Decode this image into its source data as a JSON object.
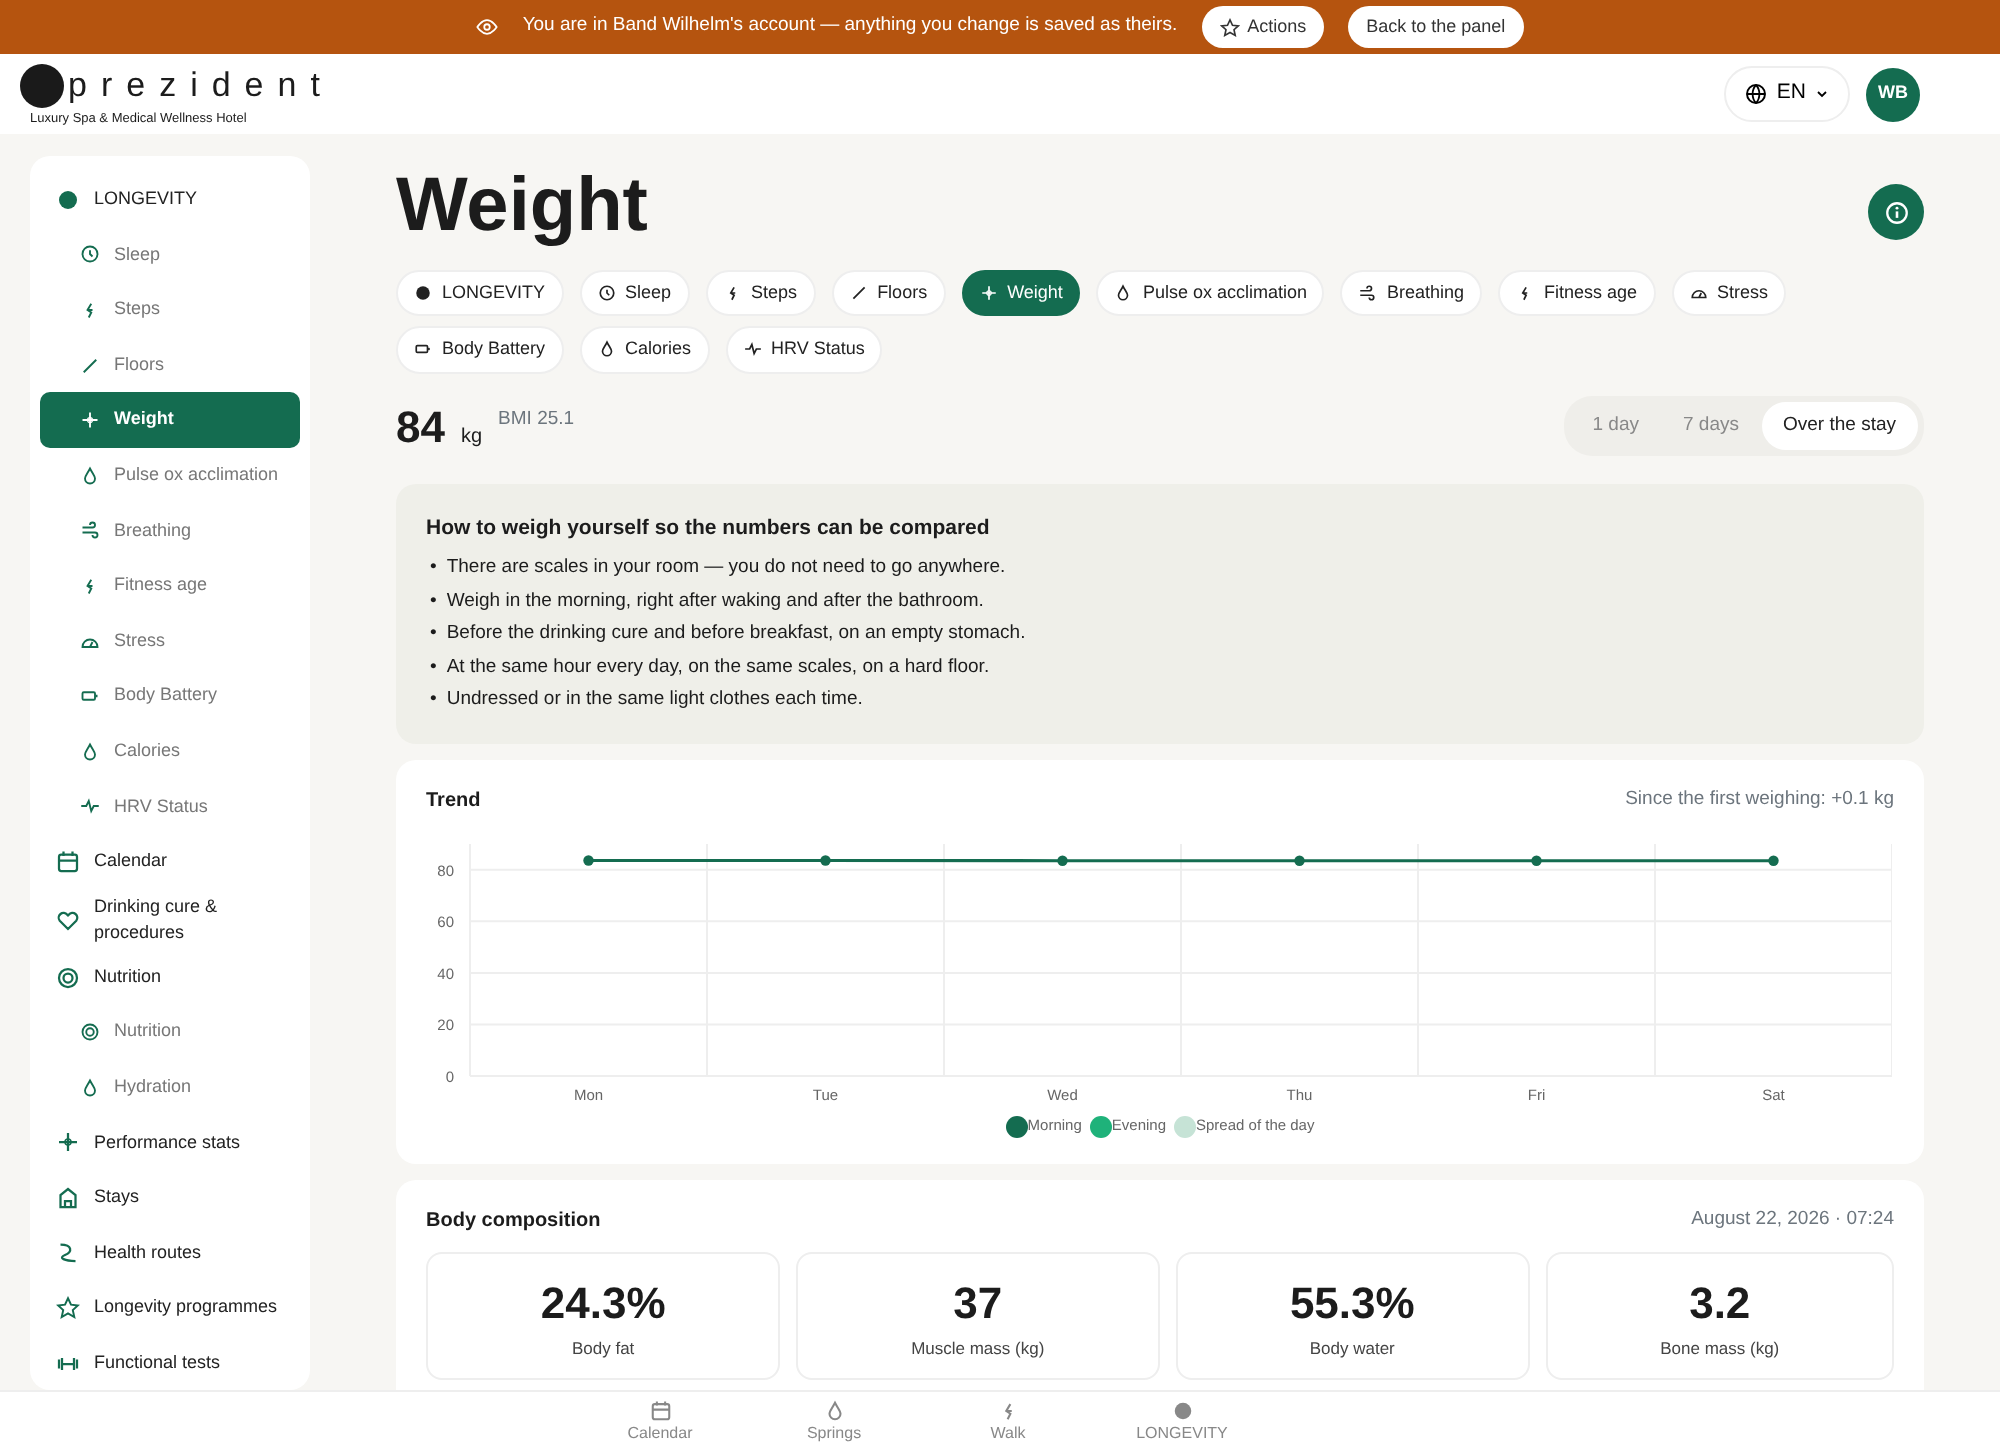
{
  "banner": {
    "text": "You are in Band Wilhelm's account — anything you change is saved as theirs.",
    "buttons": [
      {
        "label": "Actions",
        "kind": "icon"
      },
      {
        "label": "Back to the panel",
        "kind": "plain"
      }
    ]
  },
  "header": {
    "logo": {
      "name": "prezident",
      "tagline": "Luxury Spa & Medical Wellness Hotel"
    },
    "language": "EN",
    "avatar": "WB"
  },
  "sidebar": {
    "items": [
      {
        "label": "LONGEVITY",
        "selected": false,
        "children": [
          {
            "label": "Sleep",
            "selected": false
          },
          {
            "label": "Steps",
            "selected": false
          },
          {
            "label": "Floors",
            "selected": false
          },
          {
            "label": "Weight",
            "selected": true
          },
          {
            "label": "Pulse ox acclimation",
            "selected": false
          },
          {
            "label": "Breathing",
            "selected": false
          },
          {
            "label": "Fitness age",
            "selected": false
          },
          {
            "label": "Stress",
            "selected": false
          },
          {
            "label": "Body Battery",
            "selected": false
          },
          {
            "label": "Calories",
            "selected": false
          },
          {
            "label": "HRV Status",
            "selected": false
          }
        ]
      },
      {
        "label": "Calendar",
        "selected": false
      },
      {
        "label": "Drinking cure & procedures",
        "selected": false
      },
      {
        "label": "Nutrition",
        "selected": false,
        "children": [
          {
            "label": "Nutrition",
            "selected": false
          },
          {
            "label": "Hydration",
            "selected": false
          }
        ]
      },
      {
        "label": "Performance stats",
        "selected": false
      },
      {
        "label": "Stays",
        "selected": false
      },
      {
        "label": "Health routes",
        "selected": false
      },
      {
        "label": "Longevity programmes",
        "selected": false
      },
      {
        "label": "Functional tests",
        "selected": false
      }
    ]
  },
  "page": {
    "title": "Weight",
    "tabs": [
      {
        "label": "LONGEVITY",
        "selected": false
      },
      {
        "label": "Sleep",
        "selected": false
      },
      {
        "label": "Steps",
        "selected": false
      },
      {
        "label": "Floors",
        "selected": false
      },
      {
        "label": "Weight",
        "selected": true
      },
      {
        "label": "Pulse ox acclimation",
        "selected": false
      },
      {
        "label": "Breathing",
        "selected": false
      },
      {
        "label": "Fitness age",
        "selected": false
      },
      {
        "label": "Stress",
        "selected": false
      },
      {
        "label": "Body Battery",
        "selected": false
      },
      {
        "label": "Calories",
        "selected": false
      },
      {
        "label": "HRV Status",
        "selected": false
      }
    ],
    "weight": {
      "value": "84",
      "unit": "kg",
      "bmi": "BMI 25.1"
    },
    "ranges": [
      {
        "label": "1 day",
        "selected": false
      },
      {
        "label": "7 days",
        "selected": false
      },
      {
        "label": "Over the stay",
        "selected": true
      }
    ],
    "tips": {
      "title": "How to weigh yourself so the numbers can be compared",
      "items": [
        {
          "bullet": "•",
          "text": "There are scales in your room — you do not need to go anywhere."
        },
        {
          "bullet": "•",
          "text": "Weigh in the morning, right after waking and after the bathroom."
        },
        {
          "bullet": "•",
          "text": "Before the drinking cure and before breakfast, on an empty stomach."
        },
        {
          "bullet": "•",
          "text": "At the same hour every day, on the same scales, on a hard floor."
        },
        {
          "bullet": "•",
          "text": "Undressed or in the same light clothes each time."
        }
      ]
    },
    "trend": {
      "title": "Trend",
      "summary": "Since the first weighing: +0.1 kg",
      "chart_data": {
        "type": "line",
        "categories": [
          "Mon",
          "Tue",
          "Wed",
          "Thu",
          "Fri",
          "Sat"
        ],
        "ylim": [
          0,
          90
        ],
        "yticks": [
          0,
          20,
          40,
          60,
          80
        ],
        "grid": true,
        "series": [
          {
            "name": "Morning",
            "color": "#146c50",
            "marker": "circle",
            "values": [
              83.6,
              83.6,
              83.5,
              83.5,
              83.5,
              83.5
            ]
          },
          {
            "name": "Evening",
            "color": "#1fb27a",
            "values": [
              null,
              null,
              null,
              null,
              null,
              null
            ]
          },
          {
            "name": "Spread of the day",
            "color": "#c6e3d6",
            "values": [
              null,
              null,
              null,
              null,
              null,
              null
            ]
          }
        ]
      }
    },
    "composition": {
      "title": "Body composition",
      "date": "August 22, 2026 · 07:24",
      "stats": [
        {
          "value": "24.3%",
          "label": "Body fat"
        },
        {
          "value": "37",
          "label": "Muscle mass (kg)"
        },
        {
          "value": "55.3%",
          "label": "Body water"
        },
        {
          "value": "3.2",
          "label": "Bone mass (kg)"
        }
      ]
    }
  },
  "bottom_nav": [
    {
      "label": "Calendar"
    },
    {
      "label": "Springs"
    },
    {
      "label": "Walk"
    },
    {
      "label": "LONGEVITY"
    }
  ]
}
